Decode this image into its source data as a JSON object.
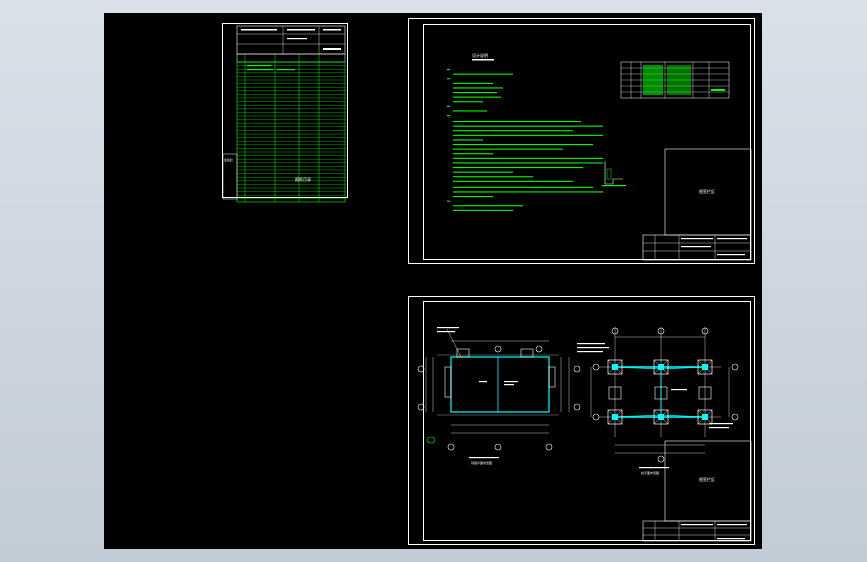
{
  "colors": {
    "background_gradient_top": "#d9e0e8",
    "background_gradient_bottom": "#c2ccd6",
    "model_space": "#000000",
    "frame_line": "#ffffff",
    "annotation": "#00ff00",
    "structure": "#00ffff",
    "magenta": "#ff00ff"
  },
  "sheets": {
    "drawing_list": {
      "stamp_label": "会签栏",
      "watermark": "图纸目录"
    },
    "general_notes": {
      "title": "设计说明",
      "stamp_box_text": "图签栏区"
    },
    "foundation_plan": {
      "plan_title_left": "基础平面布置图",
      "plan_title_right": "柱平面布置图",
      "stamp_box_text": "图签栏区"
    }
  },
  "icons": [
    "grid-bubble-icon",
    "north-arrow-icon",
    "section-mark-icon"
  ]
}
